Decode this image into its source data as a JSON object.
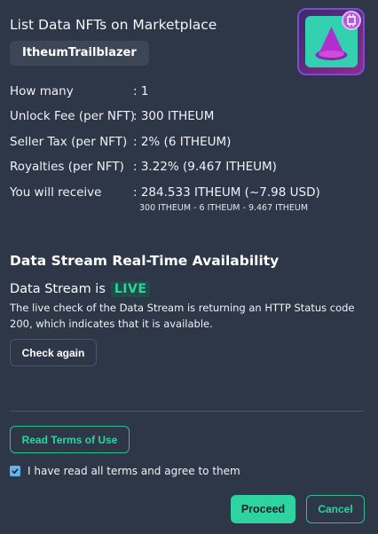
{
  "header": {
    "title": "List Data NFTs on Marketplace",
    "token_name": "ItheumTrailblazer"
  },
  "details": [
    {
      "label": "How many",
      "value": ": 1"
    },
    {
      "label": "Unlock Fee (per NFT)",
      "value": ": 300 ITHEUM"
    },
    {
      "label": "Seller Tax (per NFT)",
      "value": ": 2% (6 ITHEUM)"
    },
    {
      "label": "Royalties (per NFT)",
      "value": ": 3.22% (9.467 ITHEUM)"
    },
    {
      "label": "You will receive",
      "value": ": 284.533 ITHEUM (~7.98 USD)"
    }
  ],
  "receive_breakdown": "300 ITHEUM - 6 ITHEUM - 9.467 ITHEUM",
  "availability": {
    "heading": "Data Stream Real-Time Availability",
    "stream_prefix": "Data Stream is",
    "status": "LIVE",
    "description": "The live check of the Data Stream is returning an HTTP Status code 200, which indicates that it is available.",
    "check_again_label": "Check again"
  },
  "terms": {
    "read_terms_label": "Read Terms of Use",
    "agree_label": "I have read all terms and agree to them",
    "agree_checked": true
  },
  "actions": {
    "proceed_label": "Proceed",
    "cancel_label": "Cancel"
  },
  "colors": {
    "background": "#2d3748",
    "accent": "#2fd39f",
    "live_bg": "#1f4e49",
    "checkbox": "#63b3ed"
  }
}
